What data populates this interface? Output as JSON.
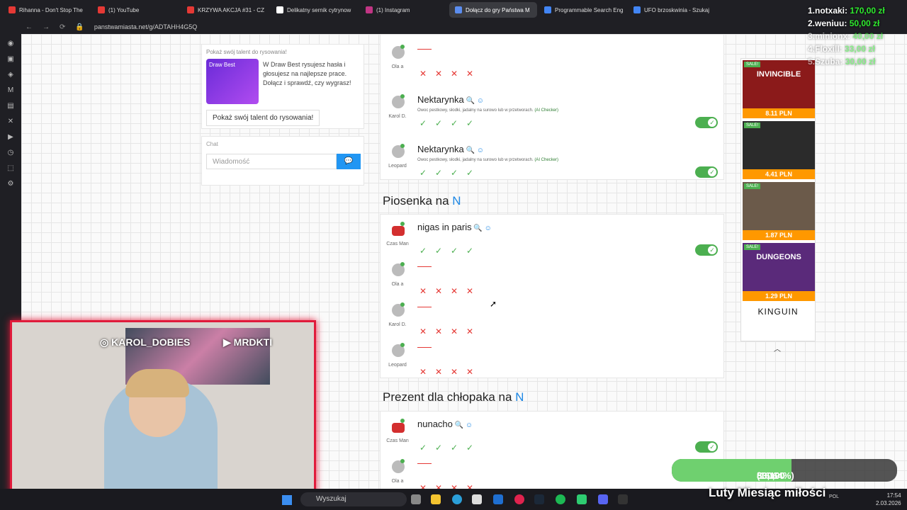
{
  "browser": {
    "tabs": [
      {
        "label": "Rihanna - Don't Stop The",
        "color": "#e53935"
      },
      {
        "label": "(1) YouTube",
        "color": "#e53935"
      },
      {
        "label": "KRZYWA AKCJA #31 - CZ",
        "color": "#e53935"
      },
      {
        "label": "Delikatny sernik cytrynow",
        "color": "#ffffff"
      },
      {
        "label": "(1) Instagram",
        "color": "#c13584"
      },
      {
        "label": "Dołącz do gry Państwa M",
        "color": "#5b8def"
      },
      {
        "label": "Programmable Search Eng",
        "color": "#4285f4"
      },
      {
        "label": "UFO brzoskwinia - Szukaj",
        "color": "#4285f4"
      }
    ],
    "active_tab_index": 5,
    "url": "panstwamiasta.net/g/ADTAHH4G5Q"
  },
  "sidebar": {
    "promo_title": "Pokaż swój talent do rysowania!",
    "promo_thumb": "Draw Best",
    "promo_text": "W Draw Best rysujesz hasła i głosujesz na najlepsze prace. Dołącz i sprawdź, czy wygrasz!",
    "promo_button": "Pokaż swój talent do rysowania!",
    "chat_title": "Chat",
    "chat_placeholder": "Wiadomość"
  },
  "ai_note": "Owoc pestkowy, słodki, jadalny na surowo lub w przetworach.",
  "ai_checker": "(AI Checker)",
  "entries_top": [
    {
      "user": "Ola a",
      "answer": "",
      "marks": [
        "x",
        "x",
        "x",
        "x"
      ],
      "toggle": false
    },
    {
      "user": "Karol D.",
      "answer": "Nektarynka",
      "marks": [
        "ok",
        "ok",
        "ok",
        "ok"
      ],
      "toggle": true
    },
    {
      "user": "Leopard",
      "answer": "Nektarynka",
      "marks": [
        "ok",
        "ok",
        "ok",
        "ok"
      ],
      "toggle": true
    }
  ],
  "section1": {
    "prefix": "Piosenka na ",
    "letter": "N"
  },
  "entries_s1": [
    {
      "user": "Czas Man",
      "answer": "nigas in paris",
      "marks": [
        "ok",
        "ok",
        "ok",
        "ok"
      ],
      "toggle": true,
      "red": true
    },
    {
      "user": "Ola a",
      "answer": "",
      "marks": [
        "x",
        "x",
        "x",
        "x"
      ],
      "toggle": false
    },
    {
      "user": "Karol D.",
      "answer": "",
      "marks": [
        "x",
        "x",
        "x",
        "x"
      ],
      "toggle": false
    },
    {
      "user": "Leopard",
      "answer": "",
      "marks": [
        "x",
        "x",
        "x",
        "x"
      ],
      "toggle": false
    }
  ],
  "section2": {
    "prefix": "Prezent dla chłopaka na ",
    "letter": "N"
  },
  "entries_s2": [
    {
      "user": "Czas Man",
      "answer": "nunacho",
      "marks": [
        "ok",
        "ok",
        "ok",
        "ok"
      ],
      "toggle": true,
      "red": true
    },
    {
      "user": "Ola a",
      "answer": "",
      "marks": [
        "x",
        "x",
        "x",
        "x"
      ],
      "toggle": false
    }
  ],
  "ads": [
    {
      "title": "INVINCIBLE",
      "price": "8.11 PLN",
      "sale": "SALE!",
      "color": "#8b1a1a"
    },
    {
      "title": "",
      "price": "4.41 PLN",
      "sale": "SALE!",
      "color": "#2b2b2b"
    },
    {
      "title": "",
      "price": "1.87 PLN",
      "sale": "SALE!",
      "color": "#6b5a4a"
    },
    {
      "title": "DUNGEONS",
      "price": "1.29 PLN",
      "sale": "SALE!",
      "color": "#5a2a7a"
    }
  ],
  "ad_brand": "KINGUIN",
  "overlay": {
    "leaderboard": [
      {
        "rank": "1.notxaki:",
        "amount": "170,00 zł"
      },
      {
        "rank": "2.weniuu:",
        "amount": "50,00 zł"
      },
      {
        "rank": "3.minionx:",
        "amount": "40,00 zł"
      },
      {
        "rank": "4.Floxill:",
        "amount": "33,00 zł"
      },
      {
        "rank": "5.Szuba:",
        "amount": "30,00 zł"
      }
    ],
    "goal_current": "83,19 zł",
    "goal_target": "500,00 zł",
    "goal_percent": "(16.64%)",
    "goal_fraction": 0.1664,
    "goal_name": "Luty Miesiąc miłości",
    "cam_instagram": "KAROL_DOBIES",
    "cam_youtube": "MRDKTI"
  },
  "taskbar": {
    "search": "Wyszukaj",
    "lang": "POL",
    "time": "17:54",
    "date": "2.03.2026"
  }
}
